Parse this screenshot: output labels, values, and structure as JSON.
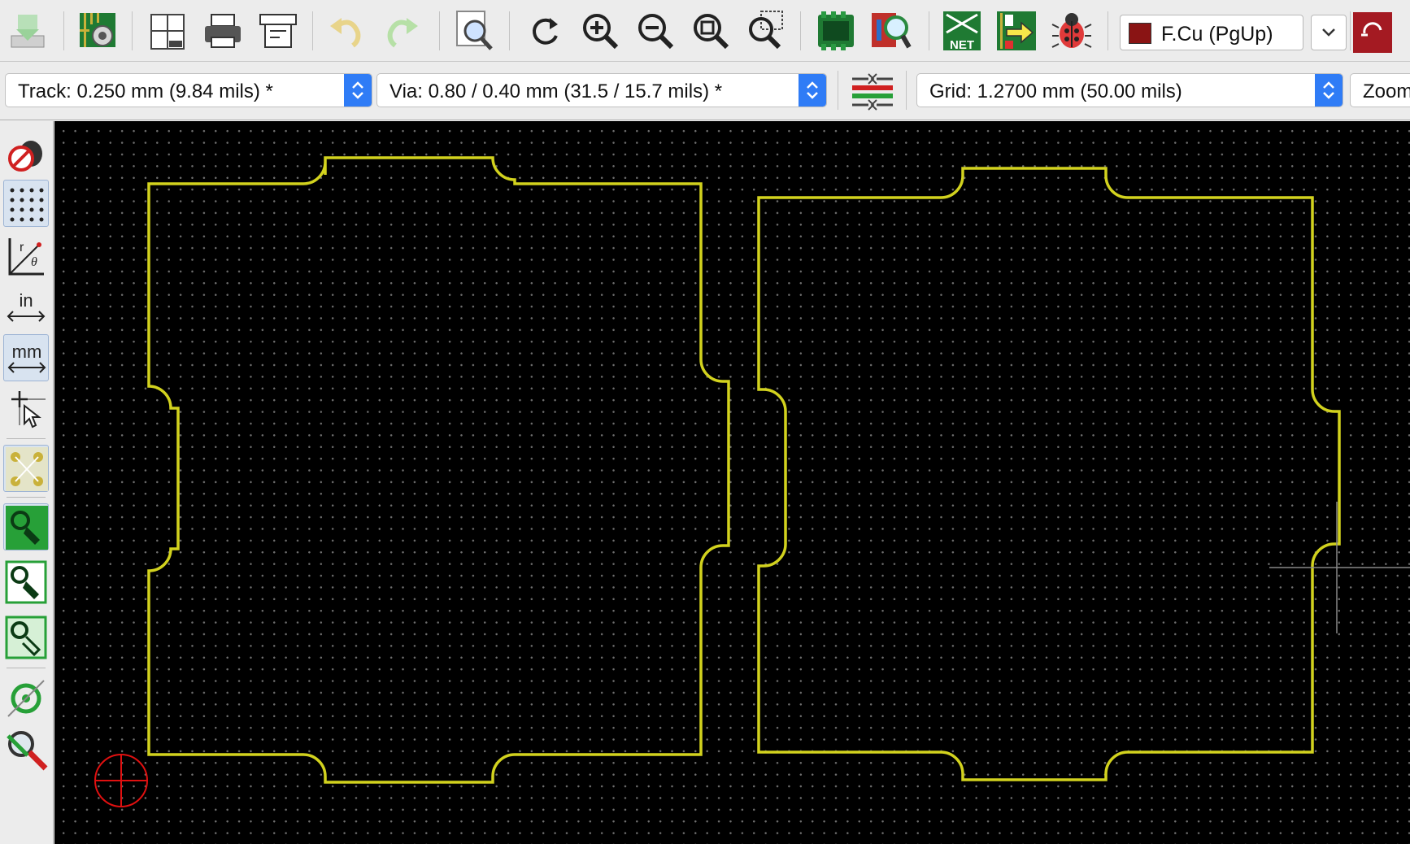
{
  "toolbar": {
    "buttons": [
      {
        "name": "save-icon",
        "tooltip": ""
      },
      {
        "name": "board-setup-icon"
      },
      {
        "name": "page-settings-icon"
      },
      {
        "name": "print-icon"
      },
      {
        "name": "plot-icon"
      },
      {
        "name": "undo-icon"
      },
      {
        "name": "redo-icon"
      },
      {
        "name": "find-icon"
      },
      {
        "name": "refresh-icon"
      },
      {
        "name": "zoom-in-icon"
      },
      {
        "name": "zoom-out-icon"
      },
      {
        "name": "zoom-fit-icon"
      },
      {
        "name": "zoom-area-icon"
      },
      {
        "name": "footprint-editor-icon"
      },
      {
        "name": "footprint-browser-icon"
      },
      {
        "name": "netlist-icon"
      },
      {
        "name": "update-pcb-from-schematic-icon"
      },
      {
        "name": "drc-bug-icon"
      }
    ],
    "layer_select": {
      "label": "F.Cu (PgUp)",
      "color": "#8a1414"
    }
  },
  "toolbar2": {
    "track": "Track: 0.250 mm (9.84 mils) *",
    "via": "Via: 0.80 / 0.40 mm (31.5 / 15.7 mils) *",
    "grid": "Grid: 1.2700 mm (50.00 mils)",
    "zoom": "Zoom"
  },
  "left_toolbar": {
    "buttons": [
      {
        "name": "drc-off-icon"
      },
      {
        "name": "grid-toggle-icon"
      },
      {
        "name": "polar-coords-icon"
      },
      {
        "name": "units-inches-icon",
        "label": "in"
      },
      {
        "name": "units-mm-icon",
        "label": "mm"
      },
      {
        "name": "cursor-shape-icon"
      },
      {
        "name": "ratsnest-icon"
      },
      {
        "name": "zone-filled-icon"
      },
      {
        "name": "zone-outline-icon"
      },
      {
        "name": "zone-sketch-icon"
      },
      {
        "name": "via-icon"
      },
      {
        "name": "high-contrast-icon"
      }
    ]
  },
  "canvas": {
    "background": "#000000",
    "outline_color": "#d2d21e",
    "grid_color": "#6e6e6e",
    "origin_marker_color": "#e01010",
    "cursor_color": "#888888"
  }
}
